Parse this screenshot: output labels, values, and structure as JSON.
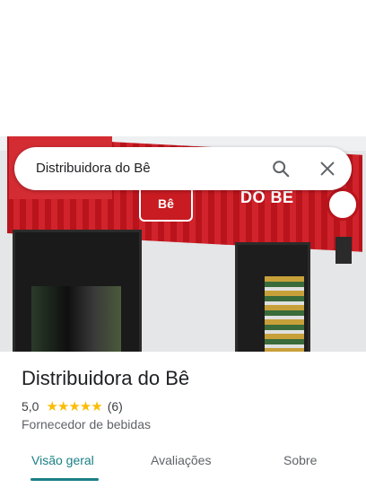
{
  "search": {
    "query": "Distribuidora do Bê",
    "search_icon": "search-icon",
    "close_icon": "close-icon"
  },
  "photo": {
    "banner_text": "DO BÊ",
    "logo_text": "Bê"
  },
  "place": {
    "name": "Distribuidora do Bê",
    "rating": "5,0",
    "stars": "★★★★★",
    "review_count": "(6)",
    "category": "Fornecedor de bebidas"
  },
  "tabs": [
    {
      "label": "Visão geral",
      "active": true
    },
    {
      "label": "Avaliações",
      "active": false
    },
    {
      "label": "Sobre",
      "active": false
    }
  ],
  "colors": {
    "accent": "#1a7f86",
    "star": "#fbbc04"
  }
}
